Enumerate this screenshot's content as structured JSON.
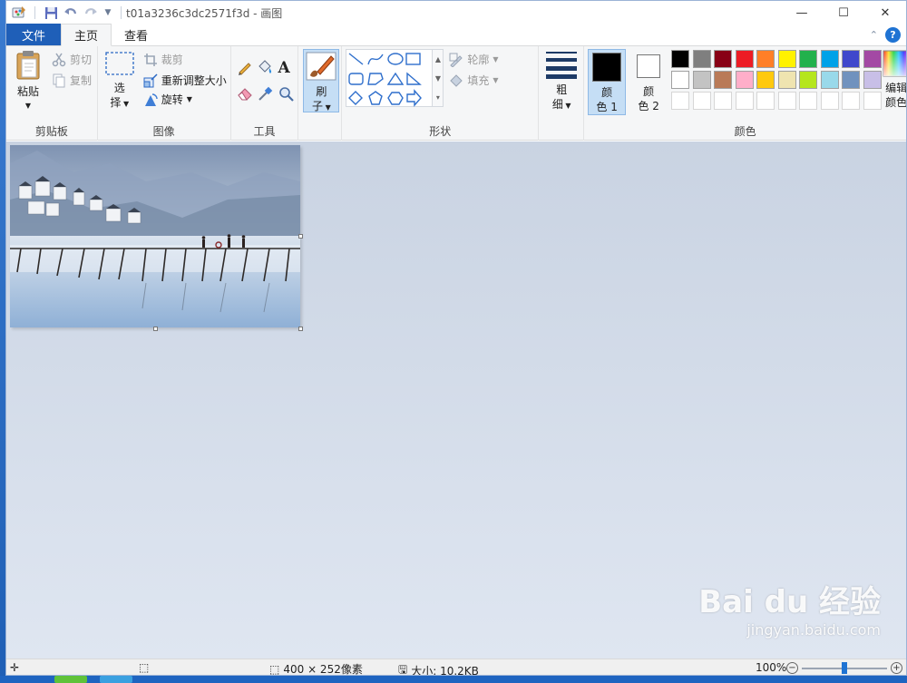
{
  "window": {
    "title": "t01a3236c3dc2571f3d - 画图",
    "controls": [
      "—",
      "☐",
      "✕"
    ]
  },
  "tabs": {
    "file": "文件",
    "home": "主页",
    "view": "查看"
  },
  "ribbon": {
    "clipboard": {
      "paste": "粘贴",
      "cut": "剪切",
      "copy": "复制",
      "label": "剪贴板"
    },
    "image": {
      "select_1": "选",
      "select_2": "择",
      "crop": "裁剪",
      "resize": "重新调整大小",
      "rotate": "旋转",
      "label": "图像"
    },
    "tools": {
      "label": "工具"
    },
    "brushes": {
      "label_1": "刷",
      "label_2": "子"
    },
    "shapes": {
      "outline": "轮廓",
      "fill": "填充",
      "label": "形状"
    },
    "size": {
      "label_1": "粗",
      "label_2": "细"
    },
    "colors": {
      "color1_1": "颜",
      "color1_2": "色 1",
      "color2_1": "颜",
      "color2_2": "色 2",
      "edit_1": "编辑",
      "edit_2": "颜色",
      "label": "颜色",
      "color1_value": "#000000",
      "color2_value": "#ffffff",
      "palette_row1": [
        "#000000",
        "#7f7f7f",
        "#880015",
        "#ed1c24",
        "#ff7f27",
        "#fff200",
        "#22b14c",
        "#00a2e8",
        "#3f48cc",
        "#a349a4"
      ],
      "palette_row2": [
        "#ffffff",
        "#c3c3c3",
        "#b97a57",
        "#ffaec9",
        "#ffc90e",
        "#efe4b0",
        "#b5e61d",
        "#99d9ea",
        "#7092be",
        "#c8bfe7"
      ]
    }
  },
  "status": {
    "dimensions": "400 × 252像素",
    "size": "大小: 10.2KB",
    "zoom": "100%",
    "zoom_level_fraction": 0.5
  },
  "watermark": {
    "line1": "Bai du 经验",
    "line2": "jingyan.baidu.com"
  }
}
